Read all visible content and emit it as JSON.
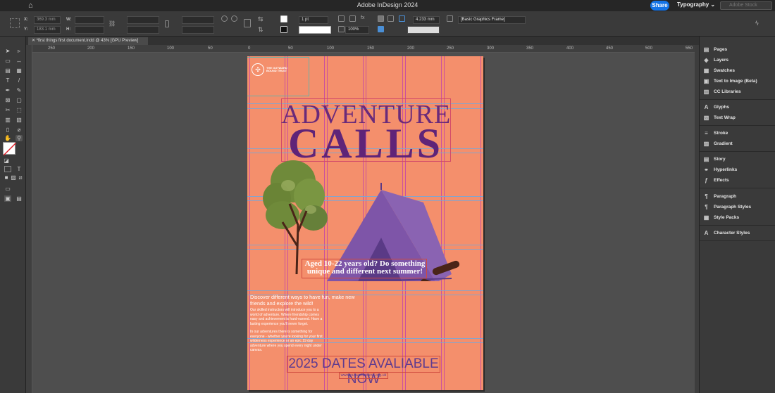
{
  "app": {
    "title": "Adobe InDesign 2024",
    "share_label": "Share",
    "workspace_label": "Typography",
    "search_placeholder": "Adobe Stock"
  },
  "control_bar": {
    "x_label": "X:",
    "x_value": "369.3 mm",
    "y_label": "Y:",
    "y_value": "183.1 mm",
    "w_label": "W:",
    "h_label": "H:",
    "stroke_weight": "1 pt",
    "opacity": "100%",
    "offset_value": "4.233 mm",
    "object_style": "[Basic Graphics Frame]"
  },
  "document_tab": {
    "label": "*first things first document.indd @ 43% [GPU Preview]"
  },
  "ruler": {
    "ticks": [
      "250",
      "200",
      "150",
      "100",
      "50",
      "0",
      "50",
      "100",
      "150",
      "200",
      "250",
      "300",
      "350",
      "400",
      "450",
      "500",
      "550"
    ]
  },
  "poster": {
    "logo_text": "THE OUTWARD BOUND TRUST",
    "heading_line1": "ADVENTURE",
    "heading_line2": "CALLS",
    "subheading": "Aged 10-22 years old? Do something unique and different next summer!",
    "intro": "Discover different ways to have fun, make new friends and explore the wild!",
    "body1": "Our skilled instructors will introduce you to a world of adventure. Where friendship comes easy and achievement is hard-earned. Have a lasting experience you'll never forget.",
    "body2": "In our adventures there is something for everyone - whether you're looking for your first wilderness experience or an epic 19 day adventure where you spend every night under canvas.",
    "dates": "2025 DATES AVALIABLE NOW",
    "url": "www.outwardbound.org.uk",
    "colors": {
      "background": "#f48f6c",
      "heading": "#5f2478",
      "tent": "#7e55a8",
      "tree": "#6f8a3a",
      "trunk": "#4a2418"
    }
  },
  "panel": {
    "items": [
      {
        "label": "Pages",
        "icon": "pages-icon"
      },
      {
        "label": "Layers",
        "icon": "layers-icon"
      },
      {
        "label": "Swatches",
        "icon": "swatches-icon"
      },
      {
        "label": "Text to Image (Beta)",
        "icon": "text-to-image-icon"
      },
      {
        "label": "CC Libraries",
        "icon": "cc-libraries-icon"
      },
      {
        "label": "Glyphs",
        "icon": "glyphs-icon"
      },
      {
        "label": "Text Wrap",
        "icon": "text-wrap-icon"
      },
      {
        "label": "Stroke",
        "icon": "stroke-icon"
      },
      {
        "label": "Gradient",
        "icon": "gradient-icon"
      },
      {
        "label": "Story",
        "icon": "story-icon"
      },
      {
        "label": "Hyperlinks",
        "icon": "hyperlinks-icon"
      },
      {
        "label": "Effects",
        "icon": "effects-icon"
      },
      {
        "label": "Paragraph",
        "icon": "paragraph-icon"
      },
      {
        "label": "Paragraph Styles",
        "icon": "paragraph-styles-icon"
      },
      {
        "label": "Style Packs",
        "icon": "style-packs-icon"
      },
      {
        "label": "Character Styles",
        "icon": "character-styles-icon"
      }
    ]
  }
}
